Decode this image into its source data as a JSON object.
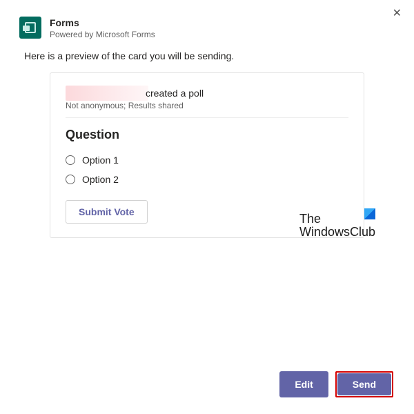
{
  "header": {
    "title": "Forms",
    "subtitle": "Powered by Microsoft Forms"
  },
  "previewLabel": "Here is a preview of the card you will be sending.",
  "card": {
    "authorSuffix": "created a poll",
    "metaSub": "Not anonymous; Results shared",
    "question": "Question",
    "options": [
      "Option 1",
      "Option 2"
    ],
    "submitLabel": "Submit Vote"
  },
  "watermark": {
    "line1": "The",
    "line2": "WindowsClub"
  },
  "footer": {
    "edit": "Edit",
    "send": "Send"
  }
}
